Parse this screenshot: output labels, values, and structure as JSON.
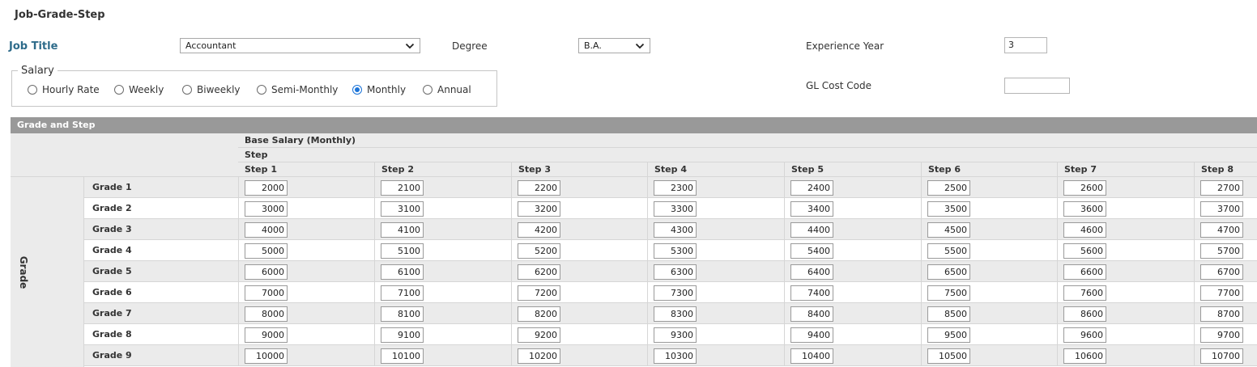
{
  "page": {
    "title": "Job-Grade-Step"
  },
  "form": {
    "job_title_label": "Job Title",
    "job_title_value": "Accountant",
    "degree_label": "Degree",
    "degree_value": "B.A.",
    "experience_label": "Experience Year",
    "experience_value": "3",
    "gl_label": "GL Cost Code",
    "gl_value": ""
  },
  "salary": {
    "legend": "Salary",
    "options": [
      {
        "label": "Hourly Rate",
        "selected": false
      },
      {
        "label": "Weekly",
        "selected": false
      },
      {
        "label": "Biweekly",
        "selected": false
      },
      {
        "label": "Semi-Monthly",
        "selected": false
      },
      {
        "label": "Monthly",
        "selected": true
      },
      {
        "label": "Annual",
        "selected": false
      }
    ]
  },
  "grid": {
    "section_title": "Grade and Step",
    "base_header": "Base Salary (Monthly)",
    "step_header": "Step",
    "grade_header": "Grade",
    "steps": [
      "Step 1",
      "Step 2",
      "Step 3",
      "Step 4",
      "Step 5",
      "Step 6",
      "Step 7",
      "Step 8"
    ],
    "grades": [
      {
        "label": "Grade 1",
        "values": [
          "2000",
          "2100",
          "2200",
          "2300",
          "2400",
          "2500",
          "2600",
          "2700"
        ]
      },
      {
        "label": "Grade 2",
        "values": [
          "3000",
          "3100",
          "3200",
          "3300",
          "3400",
          "3500",
          "3600",
          "3700"
        ]
      },
      {
        "label": "Grade 3",
        "values": [
          "4000",
          "4100",
          "4200",
          "4300",
          "4400",
          "4500",
          "4600",
          "4700"
        ]
      },
      {
        "label": "Grade 4",
        "values": [
          "5000",
          "5100",
          "5200",
          "5300",
          "5400",
          "5500",
          "5600",
          "5700"
        ]
      },
      {
        "label": "Grade 5",
        "values": [
          "6000",
          "6100",
          "6200",
          "6300",
          "6400",
          "6500",
          "6600",
          "6700"
        ]
      },
      {
        "label": "Grade 6",
        "values": [
          "7000",
          "7100",
          "7200",
          "7300",
          "7400",
          "7500",
          "7600",
          "7700"
        ]
      },
      {
        "label": "Grade 7",
        "values": [
          "8000",
          "8100",
          "8200",
          "8300",
          "8400",
          "8500",
          "8600",
          "8700"
        ]
      },
      {
        "label": "Grade 8",
        "values": [
          "9000",
          "9100",
          "9200",
          "9300",
          "9400",
          "9500",
          "9600",
          "9700"
        ]
      },
      {
        "label": "Grade 9",
        "values": [
          "10000",
          "10100",
          "10200",
          "10300",
          "10400",
          "10500",
          "10600",
          "10700"
        ]
      }
    ]
  },
  "colors": {
    "section_bar": "#999999",
    "label_accent": "#2e6b8a",
    "radio_selected": "#1a73d8",
    "row_alt": "#ebebeb"
  }
}
